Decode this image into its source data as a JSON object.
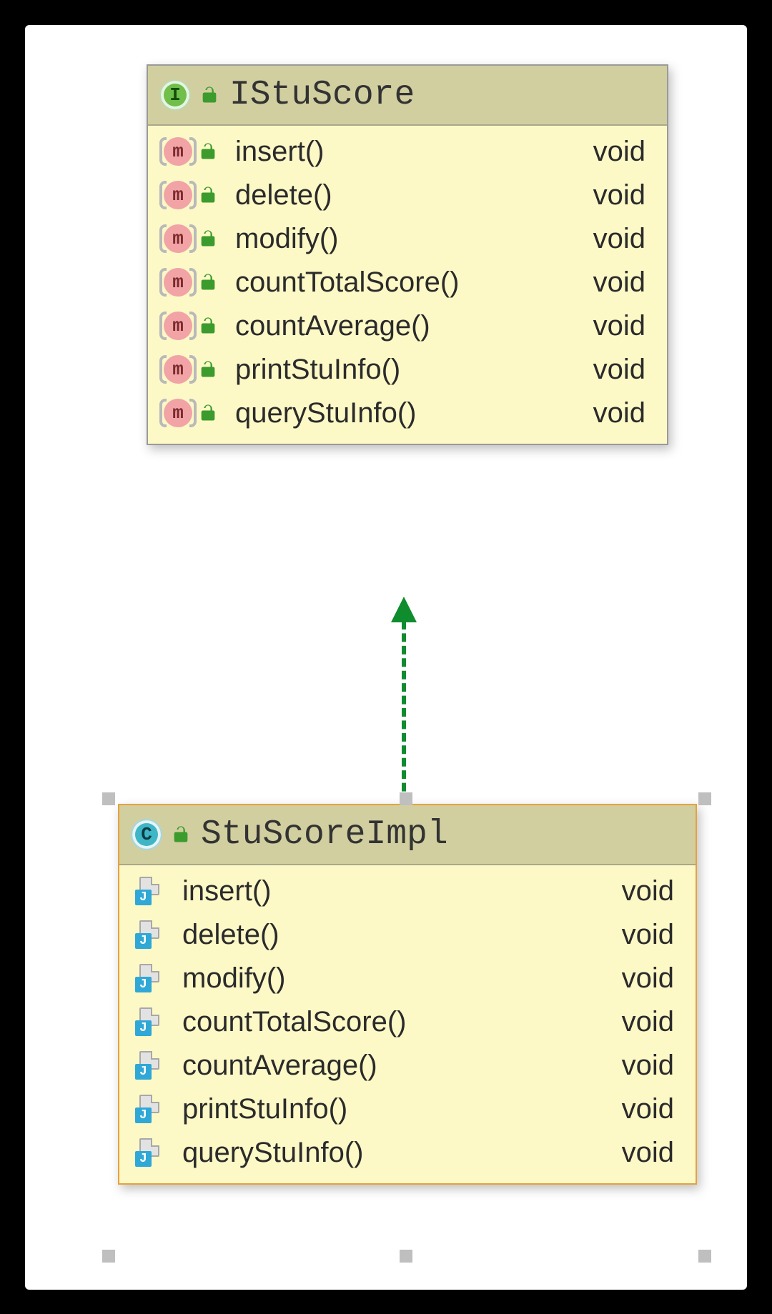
{
  "diagram": {
    "interface": {
      "name": "IStuScore",
      "kind_badge": "I",
      "methods": [
        {
          "name": "insert()",
          "returns": "void"
        },
        {
          "name": "delete()",
          "returns": "void"
        },
        {
          "name": "modify()",
          "returns": "void"
        },
        {
          "name": "countTotalScore()",
          "returns": "void"
        },
        {
          "name": "countAverage()",
          "returns": "void"
        },
        {
          "name": "printStuInfo()",
          "returns": "void"
        },
        {
          "name": "queryStuInfo()",
          "returns": "void"
        }
      ]
    },
    "class": {
      "name": "StuScoreImpl",
      "kind_badge": "C",
      "methods": [
        {
          "name": "insert()",
          "returns": "void"
        },
        {
          "name": "delete()",
          "returns": "void"
        },
        {
          "name": "modify()",
          "returns": "void"
        },
        {
          "name": "countTotalScore()",
          "returns": "void"
        },
        {
          "name": "countAverage()",
          "returns": "void"
        },
        {
          "name": "printStuInfo()",
          "returns": "void"
        },
        {
          "name": "queryStuInfo()",
          "returns": "void"
        }
      ]
    },
    "relationship": "implements"
  }
}
